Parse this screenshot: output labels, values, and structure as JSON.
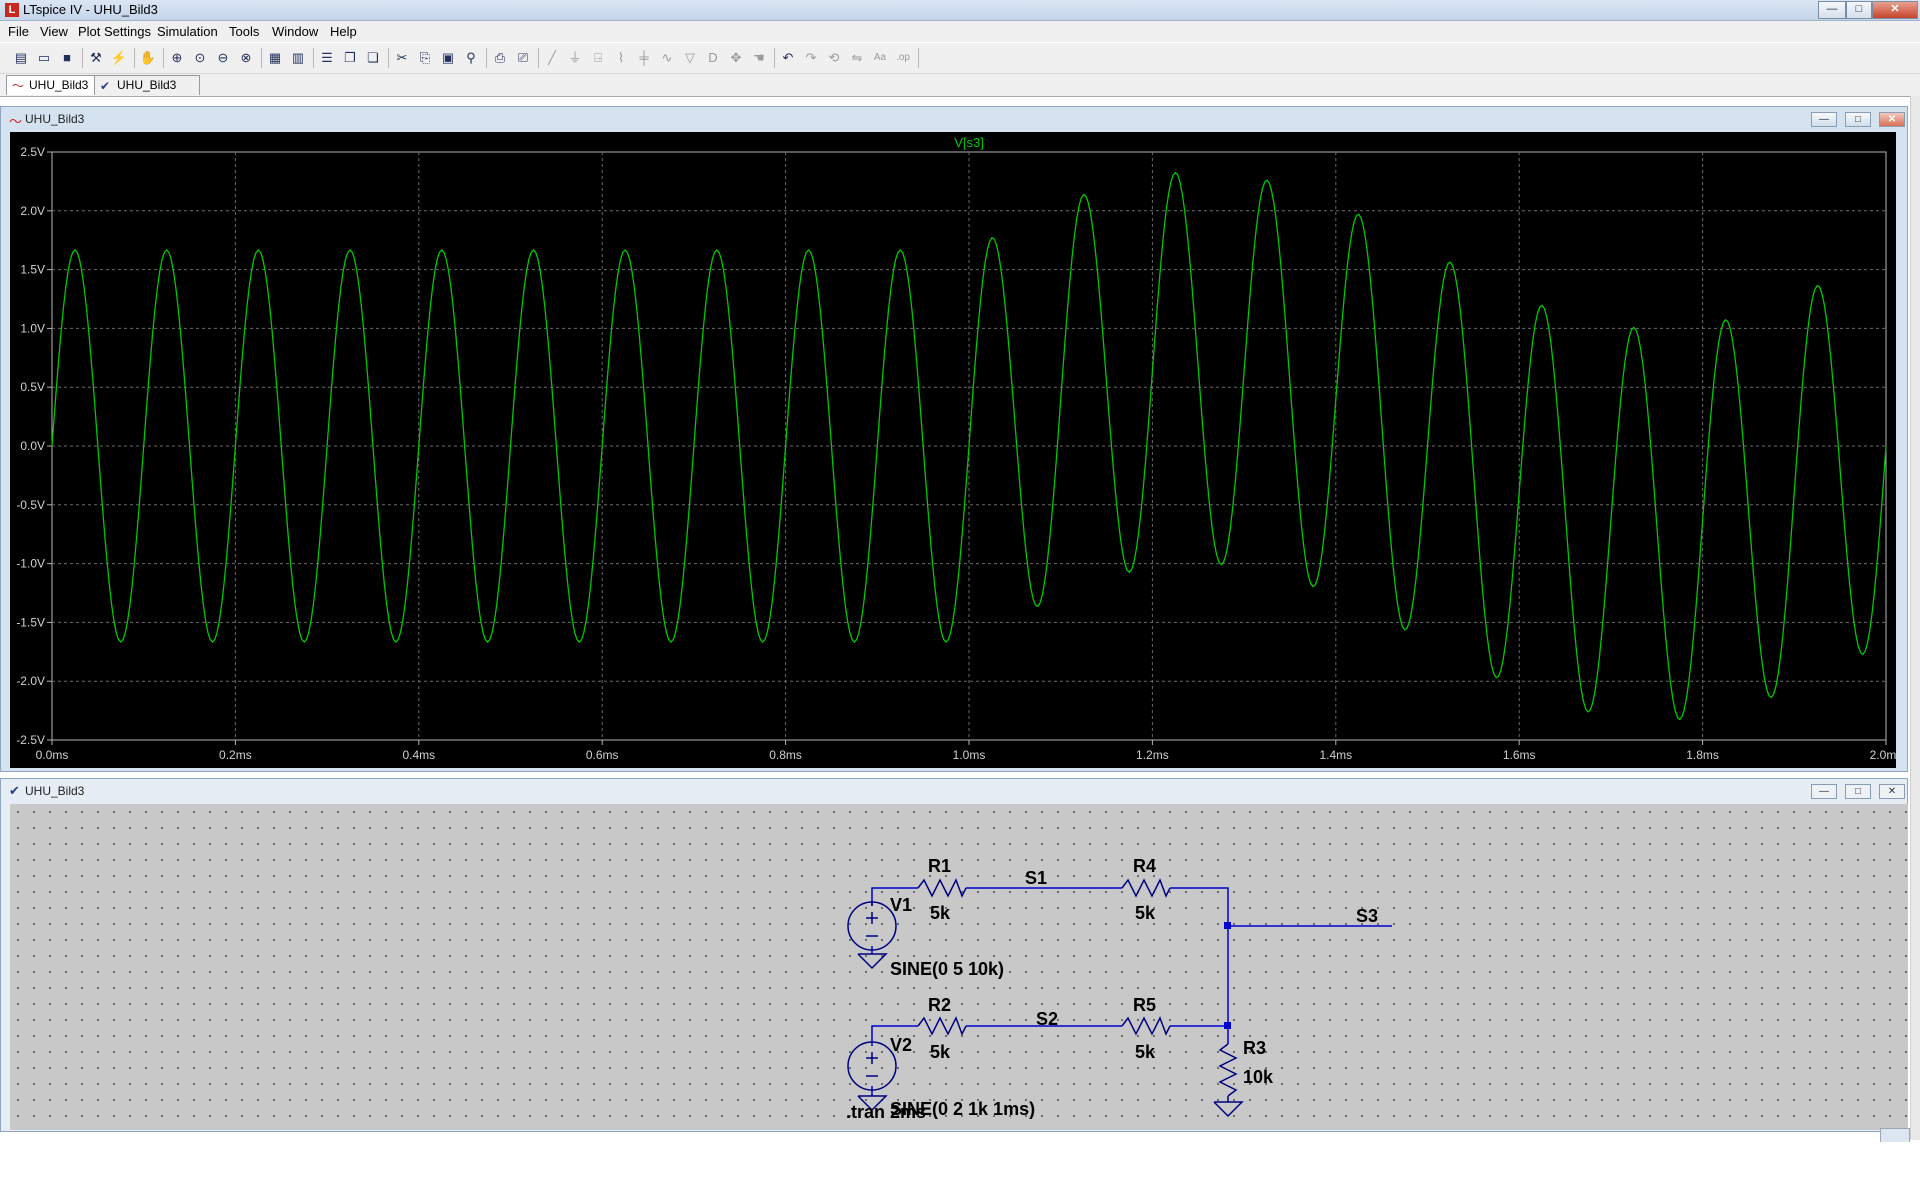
{
  "app": {
    "title": "LTspice IV - UHU_Bild3",
    "icon": "ltspice-logo-icon",
    "window_controls": {
      "minimize": "—",
      "maximize": "□",
      "close": "✕"
    }
  },
  "menu": [
    "File",
    "View",
    "Plot Settings",
    "Simulation",
    "Tools",
    "Window",
    "Help"
  ],
  "toolbar": {
    "icons": [
      {
        "name": "new-schematic-icon",
        "glyph": "▤",
        "enabled": true
      },
      {
        "name": "open-icon",
        "glyph": "▭",
        "enabled": true
      },
      {
        "name": "save-icon",
        "glyph": "■",
        "enabled": true
      },
      {
        "name": "control-panel-icon",
        "glyph": "⚒",
        "enabled": true
      },
      {
        "name": "run-icon",
        "glyph": "⚡",
        "enabled": true
      },
      {
        "name": "pan-icon",
        "glyph": "✋",
        "enabled": false
      },
      {
        "name": "zoom-in-icon",
        "glyph": "⊕",
        "enabled": true
      },
      {
        "name": "zoom-area-icon",
        "glyph": "⊙",
        "enabled": true
      },
      {
        "name": "zoom-out-icon",
        "glyph": "⊖",
        "enabled": true
      },
      {
        "name": "zoom-fit-icon",
        "glyph": "⊗",
        "enabled": true
      },
      {
        "name": "autorange-x-icon",
        "glyph": "▦",
        "enabled": true
      },
      {
        "name": "autorange-y-icon",
        "glyph": "▥",
        "enabled": true
      },
      {
        "name": "tile-horizontal-icon",
        "glyph": "☰",
        "enabled": true
      },
      {
        "name": "cascade-icon",
        "glyph": "❐",
        "enabled": true
      },
      {
        "name": "tile-vertical-icon",
        "glyph": "❏",
        "enabled": true
      },
      {
        "name": "cut-icon",
        "glyph": "✂",
        "enabled": true
      },
      {
        "name": "copy-icon",
        "glyph": "⎘",
        "enabled": true
      },
      {
        "name": "paste-icon",
        "glyph": "▣",
        "enabled": true
      },
      {
        "name": "find-icon",
        "glyph": "⚲",
        "enabled": true
      },
      {
        "name": "print-setup-icon",
        "glyph": "⎙",
        "enabled": true
      },
      {
        "name": "print-icon",
        "glyph": "⎚",
        "enabled": true
      },
      {
        "name": "wire-icon",
        "glyph": "╱",
        "enabled": false
      },
      {
        "name": "ground-icon",
        "glyph": "⏚",
        "enabled": false
      },
      {
        "name": "label-net-icon",
        "glyph": "⍈",
        "enabled": false
      },
      {
        "name": "resistor-icon",
        "glyph": "⌇",
        "enabled": false
      },
      {
        "name": "capacitor-icon",
        "glyph": "╪",
        "enabled": false
      },
      {
        "name": "inductor-icon",
        "glyph": "∿",
        "enabled": false
      },
      {
        "name": "diode-icon",
        "glyph": "▽",
        "enabled": false
      },
      {
        "name": "component-icon",
        "glyph": "D",
        "enabled": false
      },
      {
        "name": "move-icon",
        "glyph": "✥",
        "enabled": false
      },
      {
        "name": "drag-icon",
        "glyph": "☚",
        "enabled": false
      },
      {
        "name": "undo-icon",
        "glyph": "↶",
        "enabled": true
      },
      {
        "name": "redo-icon",
        "glyph": "↷",
        "enabled": false
      },
      {
        "name": "rotate-icon",
        "glyph": "⟲",
        "enabled": false
      },
      {
        "name": "mirror-icon",
        "glyph": "⇋",
        "enabled": false
      },
      {
        "name": "text-icon",
        "glyph": "Aa",
        "enabled": false
      },
      {
        "name": "spice-directive-icon",
        "glyph": ".op",
        "enabled": false
      }
    ]
  },
  "tabs": [
    {
      "label": "UHU_Bild3",
      "icon": "waveform-icon",
      "active": true
    },
    {
      "label": "UHU_Bild3",
      "icon": "schematic-icon",
      "active": false
    }
  ],
  "plot_window": {
    "title": "UHU_Bild3",
    "icon": "waveform-icon",
    "trace_label": "V[s3]",
    "trace_color": "#00c800",
    "background": "#000000",
    "grid_color": "#6a6a6a"
  },
  "schematic_window": {
    "title": "UHU_Bild3",
    "icon": "schematic-icon",
    "wire_color": "#0000d0",
    "component_color": "#000080",
    "labels": {
      "r1": "R1",
      "r1_val": "5k",
      "r4": "R4",
      "r4_val": "5k",
      "r2": "R2",
      "r2_val": "5k",
      "r5": "R5",
      "r5_val": "5k",
      "r3": "R3",
      "r3_val": "10k",
      "v1": "V1",
      "v1_val": "SINE(0 5 10k)",
      "v2": "V2",
      "v2_val": "SINE(0 2 1k 1ms)",
      "s1": "S1",
      "s2": "S2",
      "s3": "S3",
      "directive": ".tran 2ms"
    }
  },
  "chart_data": {
    "type": "line",
    "title": "V[s3]",
    "xlabel": "",
    "ylabel": "",
    "xlim": [
      0,
      2
    ],
    "ylim": [
      -2.5,
      2.5
    ],
    "x_unit": "ms",
    "x_ticks": [
      "0.0ms",
      "0.2ms",
      "0.4ms",
      "0.6ms",
      "0.8ms",
      "1.0ms",
      "1.2ms",
      "1.4ms",
      "1.6ms",
      "1.8ms",
      "2.0ms"
    ],
    "y_ticks": [
      "2.5V",
      "2.0V",
      "1.5V",
      "1.0V",
      "0.5V",
      "0.0V",
      "-0.5V",
      "-1.0V",
      "-1.5V",
      "-2.0V",
      "-2.5V"
    ],
    "grid": true,
    "series": [
      {
        "name": "V[s3]",
        "color": "#00c800",
        "sample_step_ms": 0.0025,
        "components": [
          {
            "amplitude": 1.6667,
            "frequency_khz": 10,
            "start_ms": 0
          },
          {
            "amplitude": 0.6667,
            "frequency_khz": 1,
            "start_ms": 1
          }
        ]
      }
    ]
  }
}
